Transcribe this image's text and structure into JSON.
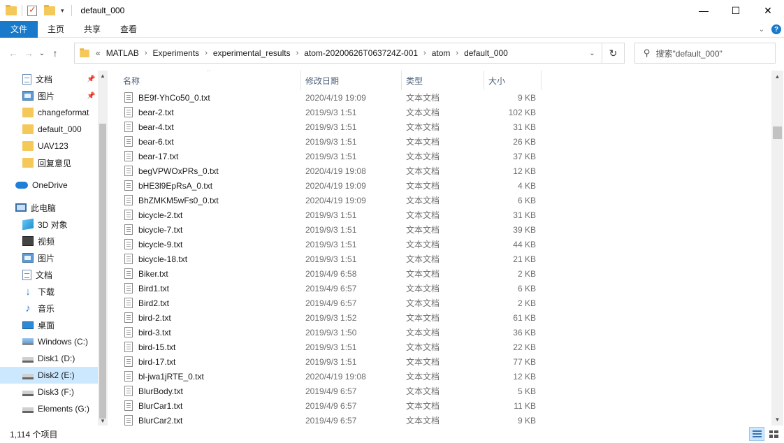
{
  "window": {
    "title": "default_000",
    "controls": {
      "minimize": "—",
      "maximize": "☐",
      "close": "✕"
    }
  },
  "ribbon": {
    "tabs": [
      "文件",
      "主页",
      "共享",
      "查看"
    ],
    "collapse_glyph": "⌄",
    "help_glyph": "?"
  },
  "nav_buttons": {
    "back": "←",
    "forward": "→",
    "recent": "⌄",
    "up": "↑"
  },
  "address": {
    "lead": "«",
    "crumbs": [
      "MATLAB",
      "Experiments",
      "experimental_results",
      "atom-20200626T063724Z-001",
      "atom",
      "default_000"
    ],
    "separator": "›",
    "dropdown": "⌄",
    "refresh": "↻"
  },
  "search": {
    "placeholder": "搜索\"default_000\"",
    "icon": "search-icon"
  },
  "navpane": {
    "items": [
      {
        "label": "文档",
        "icon": "document-icon",
        "pinned": true
      },
      {
        "label": "图片",
        "icon": "picture-icon",
        "pinned": true
      },
      {
        "label": "changeformat",
        "icon": "folder-icon"
      },
      {
        "label": "default_000",
        "icon": "folder-icon"
      },
      {
        "label": "UAV123",
        "icon": "folder-icon"
      },
      {
        "label": "回复意见",
        "icon": "folder-icon"
      },
      {
        "label": "OneDrive",
        "icon": "onedrive-icon"
      },
      {
        "label": "此电脑",
        "icon": "computer-icon"
      },
      {
        "label": "3D 对象",
        "icon": "3d-objects-icon"
      },
      {
        "label": "视频",
        "icon": "video-icon"
      },
      {
        "label": "图片",
        "icon": "picture-icon"
      },
      {
        "label": "文档",
        "icon": "document-icon"
      },
      {
        "label": "下载",
        "icon": "download-icon"
      },
      {
        "label": "音乐",
        "icon": "music-icon"
      },
      {
        "label": "桌面",
        "icon": "desktop-icon"
      },
      {
        "label": "Windows (C:)",
        "icon": "windows-drive-icon"
      },
      {
        "label": "Disk1 (D:)",
        "icon": "drive-icon"
      },
      {
        "label": "Disk2 (E:)",
        "icon": "drive-icon",
        "selected": true
      },
      {
        "label": "Disk3 (F:)",
        "icon": "drive-icon"
      },
      {
        "label": "Elements (G:)",
        "icon": "drive-icon"
      }
    ],
    "pin_glyph": "📌"
  },
  "columns": {
    "name": "名称",
    "date": "修改日期",
    "type": "类型",
    "size": "大小",
    "sort_glyph": "^"
  },
  "files": [
    {
      "name": "BE9f-YhCo50_0.txt",
      "date": "2020/4/19 19:09",
      "type": "文本文档",
      "size": "9 KB"
    },
    {
      "name": "bear-2.txt",
      "date": "2019/9/3 1:51",
      "type": "文本文档",
      "size": "102 KB"
    },
    {
      "name": "bear-4.txt",
      "date": "2019/9/3 1:51",
      "type": "文本文档",
      "size": "31 KB"
    },
    {
      "name": "bear-6.txt",
      "date": "2019/9/3 1:51",
      "type": "文本文档",
      "size": "26 KB"
    },
    {
      "name": "bear-17.txt",
      "date": "2019/9/3 1:51",
      "type": "文本文档",
      "size": "37 KB"
    },
    {
      "name": "begVPWOxPRs_0.txt",
      "date": "2020/4/19 19:08",
      "type": "文本文档",
      "size": "12 KB"
    },
    {
      "name": "bHE3l9EpRsA_0.txt",
      "date": "2020/4/19 19:09",
      "type": "文本文档",
      "size": "4 KB"
    },
    {
      "name": "BhZMKM5wFs0_0.txt",
      "date": "2020/4/19 19:09",
      "type": "文本文档",
      "size": "6 KB"
    },
    {
      "name": "bicycle-2.txt",
      "date": "2019/9/3 1:51",
      "type": "文本文档",
      "size": "31 KB"
    },
    {
      "name": "bicycle-7.txt",
      "date": "2019/9/3 1:51",
      "type": "文本文档",
      "size": "39 KB"
    },
    {
      "name": "bicycle-9.txt",
      "date": "2019/9/3 1:51",
      "type": "文本文档",
      "size": "44 KB"
    },
    {
      "name": "bicycle-18.txt",
      "date": "2019/9/3 1:51",
      "type": "文本文档",
      "size": "21 KB"
    },
    {
      "name": "Biker.txt",
      "date": "2019/4/9 6:58",
      "type": "文本文档",
      "size": "2 KB"
    },
    {
      "name": "Bird1.txt",
      "date": "2019/4/9 6:57",
      "type": "文本文档",
      "size": "6 KB"
    },
    {
      "name": "Bird2.txt",
      "date": "2019/4/9 6:57",
      "type": "文本文档",
      "size": "2 KB"
    },
    {
      "name": "bird-2.txt",
      "date": "2019/9/3 1:52",
      "type": "文本文档",
      "size": "61 KB"
    },
    {
      "name": "bird-3.txt",
      "date": "2019/9/3 1:50",
      "type": "文本文档",
      "size": "36 KB"
    },
    {
      "name": "bird-15.txt",
      "date": "2019/9/3 1:51",
      "type": "文本文档",
      "size": "22 KB"
    },
    {
      "name": "bird-17.txt",
      "date": "2019/9/3 1:51",
      "type": "文本文档",
      "size": "77 KB"
    },
    {
      "name": "bl-jwa1jRTE_0.txt",
      "date": "2020/4/19 19:08",
      "type": "文本文档",
      "size": "12 KB"
    },
    {
      "name": "BlurBody.txt",
      "date": "2019/4/9 6:57",
      "type": "文本文档",
      "size": "5 KB"
    },
    {
      "name": "BlurCar1.txt",
      "date": "2019/4/9 6:57",
      "type": "文本文档",
      "size": "11 KB"
    },
    {
      "name": "BlurCar2.txt",
      "date": "2019/4/9 6:57",
      "type": "文本文档",
      "size": "9 KB"
    }
  ],
  "statusbar": {
    "item_count": "1,114 个项目"
  },
  "colors": {
    "accent": "#1979ca",
    "selected_bg": "#cce8ff",
    "header_text": "#4c607a",
    "meta_text": "#6d6d6d"
  }
}
